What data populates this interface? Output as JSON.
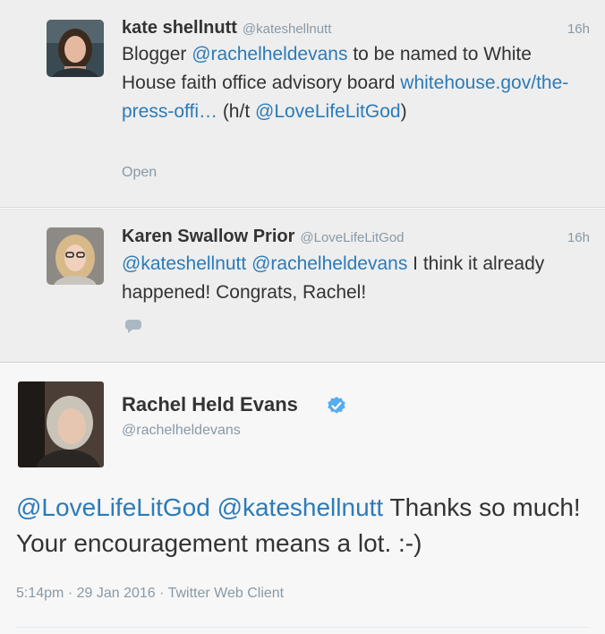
{
  "tweets": [
    {
      "name": "kate shellnutt",
      "handle": "@kateshellnutt",
      "time": "16h",
      "text": {
        "p1": "Blogger ",
        "m1": "@rachelheldevans",
        "p2": " to be named to White House faith office advisory board ",
        "l1": "whitehouse.gov/the-press-offi…",
        "p3": " (h/t ",
        "m2": "@LoveLifeLitGod",
        "p4": ")"
      },
      "action": "Open"
    },
    {
      "name": "Karen Swallow Prior",
      "handle": "@LoveLifeLitGod",
      "time": "16h",
      "text": {
        "m1": "@kateshellnutt",
        "m2": "@rachelheldevans",
        "p1": " I think it already happened! Congrats, Rachel!"
      },
      "reply_icon": "speech-bubble-icon"
    }
  ],
  "focus": {
    "name": "Rachel Held Evans",
    "verified_icon": "verified-badge-icon",
    "handle": "@rachelheldevans",
    "text": {
      "m1": "@LoveLifeLitGod",
      "m2": "@kateshellnutt",
      "p1": " Thanks so much! Your encouragement means a lot. :-)"
    },
    "meta": "5:14pm · 29 Jan 2016 · Twitter Web Client"
  },
  "colors": {
    "link": "#2b7bb9",
    "muted": "#8899a6",
    "verified": "#55acee",
    "reply_bg": "#eeeeee",
    "focus_bg": "#f7f7f7"
  }
}
